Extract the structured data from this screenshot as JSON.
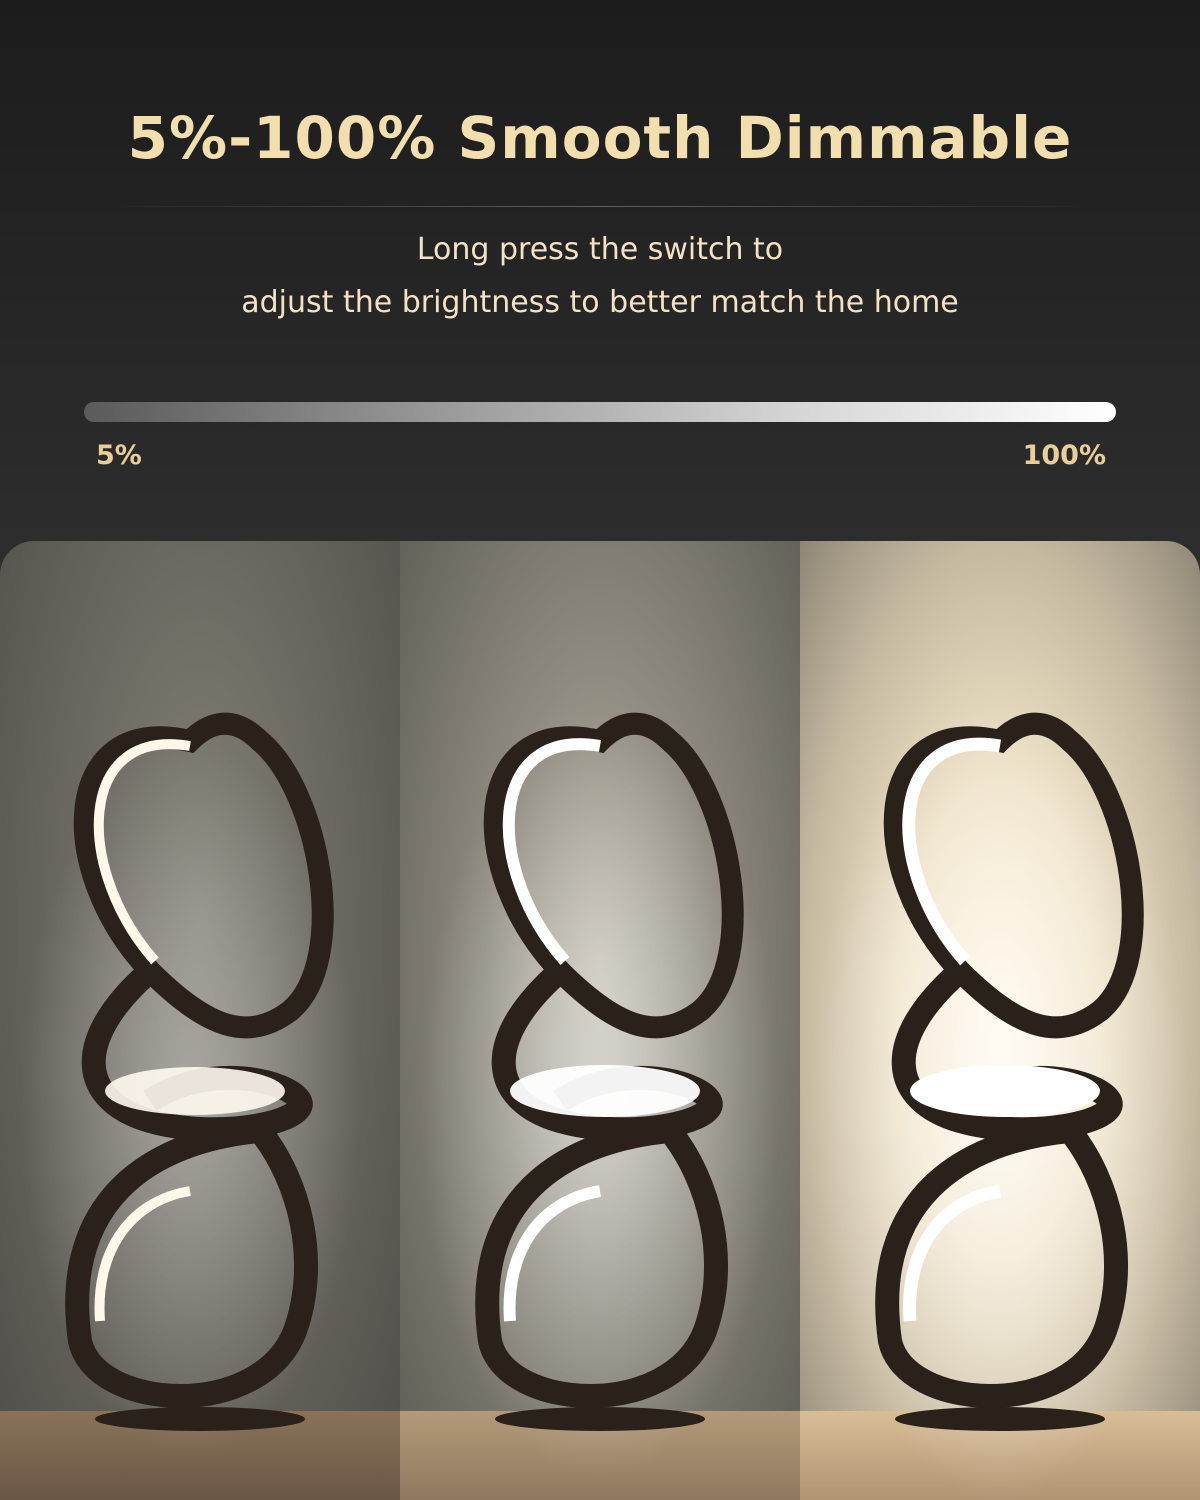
{
  "header": {
    "title": "5%-100% Smooth Dimmable",
    "subtitle_line1": "Long press the switch to",
    "subtitle_line2": "adjust the brightness to better match the home"
  },
  "brightness_scale": {
    "min_label": "5%",
    "max_label": "100%",
    "fill_fraction": 1.0
  },
  "photos": [
    {
      "name": "lamp-dim",
      "brightness_level": "low"
    },
    {
      "name": "lamp-medium",
      "brightness_level": "medium"
    },
    {
      "name": "lamp-bright",
      "brightness_level": "high"
    }
  ],
  "colors": {
    "accent_gold": "#f3dfae",
    "label_gold": "#e8cf98",
    "background": "#262626"
  }
}
